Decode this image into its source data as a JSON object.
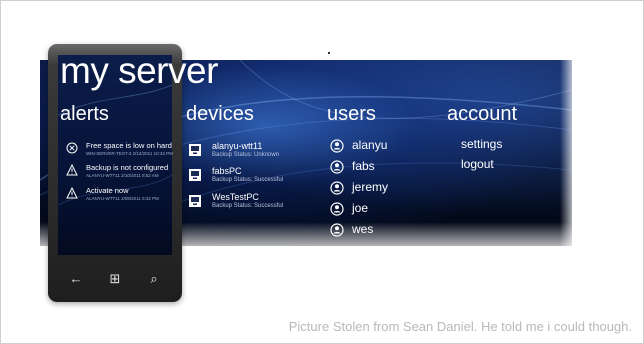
{
  "title": "my server",
  "sections": {
    "alerts": "alerts",
    "devices": "devices",
    "users": "users",
    "account": "account"
  },
  "alerts": [
    {
      "icon": "x-circle-icon",
      "title": "Free space is low on hard",
      "sub": "WIN-SERVER-TEST-2  2/12/2011  10:34 PM"
    },
    {
      "icon": "warning-icon",
      "title": "Backup is not configured",
      "sub": "ALANYU-WTT11  2/10/2011  8:52 AM"
    },
    {
      "icon": "warning-icon",
      "title": "Activate now",
      "sub": "ALANYU-WTT11  2/08/2011  5:32 PM"
    }
  ],
  "devices": [
    {
      "icon": "computer-icon",
      "name": "alanyu-wtt11",
      "status": "Backup Status: Unknown"
    },
    {
      "icon": "computer-icon",
      "name": "fabsPC",
      "status": "Backup Status: Successful"
    },
    {
      "icon": "computer-icon",
      "name": "WesTestPC",
      "status": "Backup Status: Successful"
    }
  ],
  "users": [
    {
      "icon": "user-icon",
      "name": "alanyu"
    },
    {
      "icon": "user-icon",
      "name": "fabs"
    },
    {
      "icon": "user-icon",
      "name": "jeremy"
    },
    {
      "icon": "user-icon",
      "name": "joe"
    },
    {
      "icon": "user-icon",
      "name": "wes"
    }
  ],
  "account": {
    "settings": "settings",
    "logout": "logout"
  },
  "phone_buttons": {
    "back": "←",
    "start": "⊞",
    "search": "⌕"
  },
  "caption": "Picture Stolen from Sean Daniel. He told me i could though.",
  "colors": {
    "banner": "#061130",
    "text": "#ffffff",
    "subtext": "#b8c3dd"
  }
}
